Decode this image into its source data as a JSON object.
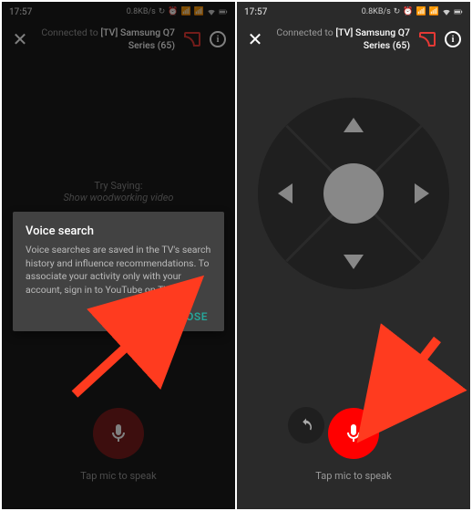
{
  "status": {
    "time": "17:57",
    "net_speed": "0.8KB/s"
  },
  "header": {
    "connected_prefix": "Connected to ",
    "device_name": "[TV] Samsung Q7 Series (65)"
  },
  "try": {
    "label": "Try Saying:",
    "example": "Show woodworking video"
  },
  "dialog": {
    "title": "Voice search",
    "body": "Voice searches are saved in the TV's search history and influence recommendations. To associate your activity only with your account, sign in to YouTube on TV.",
    "close": "CLOSE"
  },
  "mic": {
    "label": "Tap mic to speak"
  },
  "colors": {
    "accent": "#ff0000",
    "teal": "#26a69a"
  }
}
